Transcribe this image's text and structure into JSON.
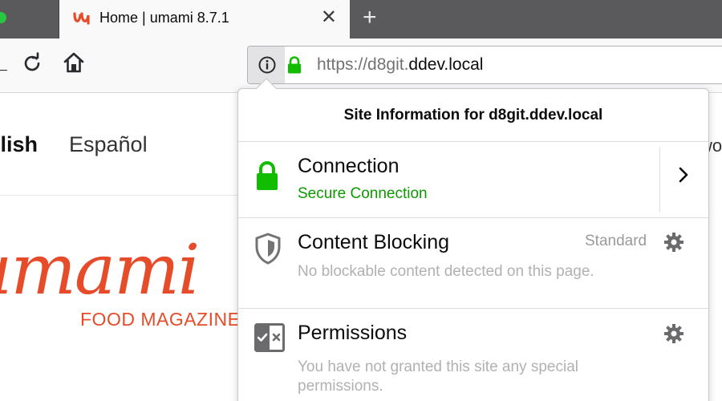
{
  "tab": {
    "title": "Home | umami 8.7.1",
    "close_glyph": "✕",
    "new_tab_glyph": "+"
  },
  "toolbar": {
    "back_glyph": "←",
    "url_scheme": "https://d8git.",
    "url_host": "ddev.local"
  },
  "page": {
    "lang_english": "glish",
    "lang_espanol": "Español",
    "lang_partial": "wo",
    "logo_text": "umami",
    "tagline": "FOOD MAGAZINE"
  },
  "panel": {
    "title": "Site Information for d8git.ddev.local",
    "connection": {
      "title": "Connection",
      "status": "Secure Connection"
    },
    "content_blocking": {
      "title": "Content Blocking",
      "level": "Standard",
      "description": "No blockable content detected on this page."
    },
    "permissions": {
      "title": "Permissions",
      "description_line1": "You have not granted this site any special",
      "description_line2": "permissions."
    }
  },
  "colors": {
    "secure_green": "#0d9a00",
    "lock_green": "#12bc00",
    "brand_red": "#e64c2a",
    "tabstrip": "#5a5a5c"
  },
  "icons": [
    "umami-favicon-icon",
    "close-icon",
    "plus-icon",
    "back-arrow-icon",
    "reload-icon",
    "home-icon",
    "info-icon",
    "lock-icon",
    "shield-icon",
    "permissions-icon",
    "chevron-right-icon",
    "gear-icon"
  ]
}
